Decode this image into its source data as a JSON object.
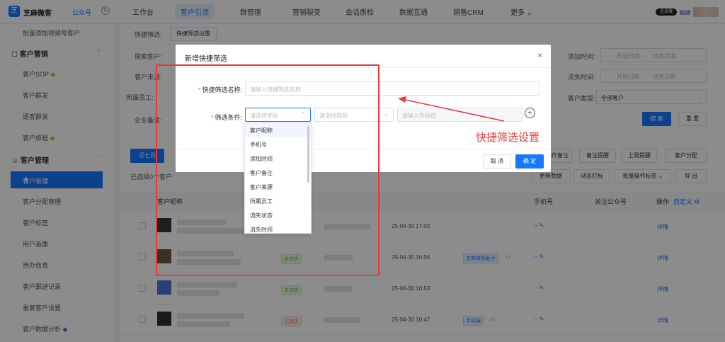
{
  "topbar": {
    "logo_glyph": "芝",
    "brand": "芝麻微客",
    "brand_sub": "公众号",
    "nav": [
      "工作台",
      "客户引流",
      "群管理",
      "营销裂变",
      "会话质检",
      "数据互通",
      "销售CRM",
      "更多 ⌄"
    ],
    "chip_logo": "企业微",
    "chip_badge": "V2"
  },
  "sidebar": {
    "top_item": "批量添加视频号客户",
    "group1": "客户营销",
    "group1_items": [
      "客户SOP",
      "客户群发",
      "逐客群发",
      "客户旅程"
    ],
    "group2": "客户管理",
    "active_item": "客户管理",
    "group2_items": [
      "客户分配管理",
      "客户标签",
      "用户画像",
      "待办信息",
      "客户跟进记录",
      "重复客户设置",
      "客户数据分析"
    ]
  },
  "main": {
    "filters": {
      "quick_label": "快捷筛选:",
      "quick_btn": "快捷筛选设置",
      "search_label": "搜索客户:",
      "source_label": "客户来源:",
      "staff_label": "所属员工:",
      "company_label": "企业备注:",
      "add_time_label": "添加时间:",
      "lost_time_label": "流失时间:",
      "customer_type_label": "客户类型:",
      "start_date": "开始日期",
      "end_date": "结束日期",
      "date_sep": "-",
      "customer_type_value": "全部客户",
      "search_btn": "搜 索",
      "reset_btn": "重 置"
    },
    "tab_label": "近七日",
    "selected_text": "已选择0个客户",
    "action_btns": [
      "批量操作备注",
      "备注提醒",
      "上限提醒",
      "客户分配"
    ],
    "action_btns2": [
      "更新数据",
      "动态打标",
      "批量操作标签 ⌄",
      "导 出"
    ],
    "table_headers": {
      "nickname": "客户昵称",
      "phone": "手机号",
      "official": "关注公众号",
      "op": "操作",
      "custom": "自定义"
    },
    "rows": [
      {
        "date": "25-04-30 17:03",
        "phone": "--",
        "op": "详情",
        "tag": "",
        "tag2": ""
      },
      {
        "date": "25-04-30 16:56",
        "phone": "--",
        "op": "详情",
        "tag": "未流失",
        "tag2": "芝麻微客助手",
        "extra": "+1"
      },
      {
        "date": "25-04-30 16:53",
        "phone": "--",
        "op": "详情",
        "tag": "未流失",
        "tag2": "",
        "extra": ""
      },
      {
        "date": "25-04-30 16:47",
        "phone": "--",
        "op": "详情",
        "tag": "已流失",
        "tag2": "手机端",
        "extra": "+2"
      }
    ]
  },
  "modal": {
    "title": "新增快捷筛选",
    "close_glyph": "×",
    "name_label": "快捷筛选名称:",
    "name_placeholder": "请输入快捷筛选名称",
    "cond_label": "筛选条件:",
    "field_placeholder": "请选择字段",
    "rule_placeholder": "请选择规则",
    "value_placeholder": "请输入字段值",
    "cancel": "取 消",
    "confirm": "确 定",
    "plus_glyph": "+"
  },
  "dropdown": {
    "options": [
      "客户昵称",
      "手机号",
      "添加时间",
      "客户备注",
      "客户来源",
      "所属员工",
      "流失状态",
      "流失时间"
    ]
  },
  "annotation": {
    "text": "快捷筛选设置",
    "color": "#e5393a"
  }
}
